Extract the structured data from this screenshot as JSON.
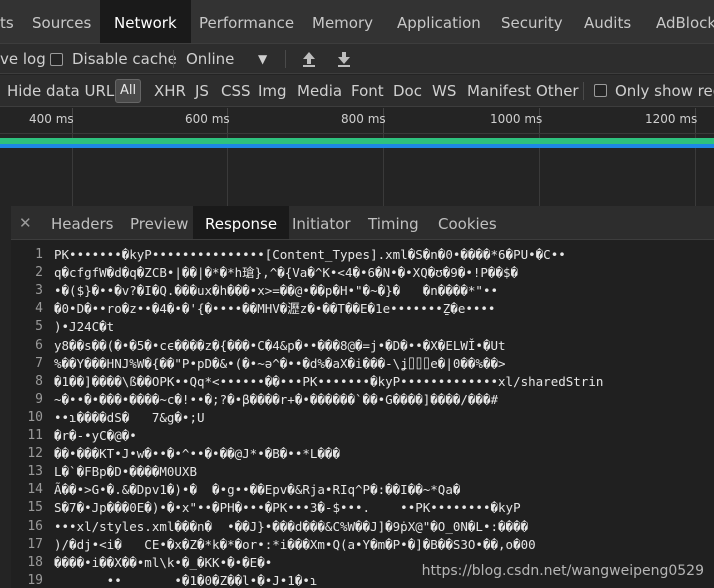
{
  "main_tabs": [
    "Sources",
    "Network",
    "Performance",
    "Memory",
    "Application",
    "Security",
    "Audits",
    "AdBlock"
  ],
  "main_tab_partial": "ts",
  "toolbar": {
    "preserve_log": "ve log",
    "disable_cache": "Disable cache",
    "throttle": "Online"
  },
  "filter": {
    "hide_data_urls": "Hide data URLs",
    "types": [
      "All",
      "XHR",
      "JS",
      "CSS",
      "Img",
      "Media",
      "Font",
      "Doc",
      "WS",
      "Manifest",
      "Other"
    ],
    "only_show": "Only show requ"
  },
  "timeline": {
    "ticks": [
      "400 ms",
      "600 ms",
      "800 ms",
      "1000 ms",
      "1200 ms"
    ]
  },
  "detail_tabs": [
    "Headers",
    "Preview",
    "Response",
    "Initiator",
    "Timing",
    "Cookies"
  ],
  "response": {
    "lines": [
      "PK•••••••�kyP•••••••••••••••[Content_Types].xml�S�n�0•����*6�PU•�C••",
      "q�cfgfW�d�q�ZCB•|��|�*�*h瑲},^�{Va�^K•<4�•6�N•�•XQ�ʊ�9�•!P��$�",
      "•�($}�••�v?�I�Q.���uх�h���•x>=��@•��p�H•\"�~�}�   �n����*\"••",
      "�0•D�••ro�z••�4�•�'{�••••��MHV�瀝z�•��T��E�1e•••••••Ẕ�e••••",
      ")•J24C�t",
      "y8��s��(�•�5�•cϵ����z�{���•C�4&p�••���8@�=j•�D�••�X�ELWǏ•�Ut",
      "%��Y���HNJ%W�{��\"P•pD�&•(�•~ə^�••�d%�aX�i���-\\ʝ⌷⌷⌷e�|0��%��>",
      "�1��]����\\ß��OPK••Qq*<••••••��•••PK•••••••�kyP•••••••••••••xl/sharedStrin",
      "~�••�•���•����~c�!••�;?�•β����r+�•������`��•G����]����/���#",
      "••ɿ����dS�   7&g�•;U",
      "�r�-•yC�@�•",
      "��•���KT•J•w�••�•^••�•��@J*•�B�••*L���",
      "L�`�FBp�D•����M0UXB",
      "Ã��•>G•�.&�Dpv1�)•�  �•g••��Epv�&Rja•RIq^P�:��I��~*Qa�",
      "S�7�•Jp���0E�)•�•x\"••�PH�•••�PK•••3�-$•••.    ••PK••••••••�kyP",
      "•••xl/styles.xml���n�  •��J}•���d���&C%W��J]�9ṗX@\"�O_0N�L•:����",
      ")/�dj•<i�   CE•�x�Z�*k�*�or•:*i���Xm•Q(a•Y�m�P•�]�B��S3O•��,o�00",
      "����•i��X��•ml\\k•�_�KK•�•�E�•",
      "       ••       •�1�0�Z��l•�•J•1�•ɿ"
    ]
  },
  "watermark": "https://blog.csdn.net/wangweipeng0529"
}
